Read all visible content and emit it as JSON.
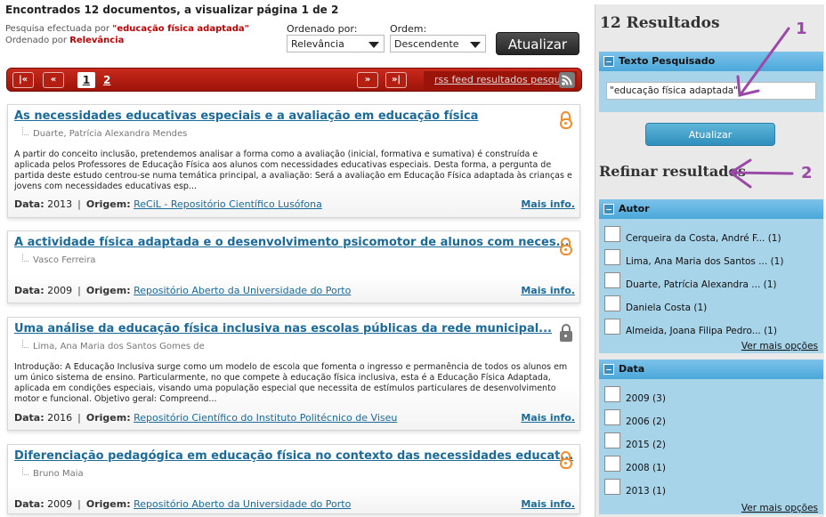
{
  "summary": {
    "title": "Encontrados 12 documentos, a visualizar página 1 de 2",
    "search_prefix": "Pesquisa efectuada por ",
    "search_value": "\"educação física adaptada\"",
    "order_prefix": "Ordenado por ",
    "order_value": "Relevância"
  },
  "sort": {
    "order_by_label": "Ordenado por:",
    "order_by_value": "Relevância",
    "order_label": "Ordem:",
    "order_value": "Descendente",
    "update_label": "Atualizar"
  },
  "pager": {
    "first": "|«",
    "prev": "«",
    "pages": [
      "1",
      "2"
    ],
    "next": "»",
    "last": "»|",
    "rss_label": "rss feed resultados pesquisa"
  },
  "results": [
    {
      "title": "As necessidades educativas especiais e a avaliação em educação física",
      "author": "Duarte, Patrícia Alexandra Mendes",
      "abstract": "A partir do conceito inclusão, pretendemos analisar a forma como a avaliação (inicial, formativa e sumativa) é construída e aplicada pelos Professores de Educação Física aos alunos com necessidades educativas especiais. Desta forma, a pergunta de partida deste estudo centrou-se numa temática principal, a avaliação: Será a avaliação em Educação Física adaptada às crianças e jovens com necessidades educativas esp...",
      "date_label": "Data:",
      "date": "2013",
      "origin_label": "Origem:",
      "origin": "ReCiL - Repositório Científico Lusófona",
      "more": "Mais info.",
      "access": "open-access-icon"
    },
    {
      "title": "A actividade física adaptada e o desenvolvimento psicomotor de alunos com neces...",
      "author": "Vasco Ferreira",
      "abstract": "",
      "date_label": "Data:",
      "date": "2009",
      "origin_label": "Origem:",
      "origin": "Repositório Aberto da Universidade do Porto",
      "more": "Mais info.",
      "access": "open-access-icon"
    },
    {
      "title": "Uma análise da educação física inclusiva nas escolas públicas da rede municipal...",
      "author": "Lima, Ana Maria dos Santos Gomes de",
      "abstract": "Introdução: A Educação Inclusiva surge como um modelo de escola que fomenta o ingresso e permanência de todos os alunos em um único sistema de ensino. Particularmente, no que compete à educação física inclusiva, esta é a Educação Física Adaptada, aplicada em condições especiais, visando uma população especial que necessita de estímulos particulares de desenvolvimento motor e funcional. Objetivo geral: Compreend...",
      "date_label": "Data:",
      "date": "2016",
      "origin_label": "Origem:",
      "origin": "Repositório Científico do Instituto Politécnico de Viseu",
      "more": "Mais info.",
      "access": "restricted-access-icon"
    },
    {
      "title": "Diferenciação pedagógica em educação física no contexto das necessidades educat...",
      "author": "Bruno Maia",
      "abstract": "",
      "date_label": "Data:",
      "date": "2009",
      "origin_label": "Origem:",
      "origin": "Repositório Aberto da Universidade do Porto",
      "more": "Mais info.",
      "access": "open-access-icon"
    }
  ],
  "sidebar": {
    "results_count": "12 Resultados",
    "search_panel_title": "Texto Pesquisado",
    "search_text": "\"educação física adaptada\"",
    "update_label": "Atualizar",
    "refine_title": "Refinar resultados",
    "author_panel_title": "Autor",
    "authors": [
      "Cerqueira da Costa, André F... (1)",
      "Lima, Ana Maria dos Santos ... (1)",
      "Duarte, Patrícia Alexandra ... (1)",
      "Daniela Costa (1)",
      "Almeida, Joana Filipa Pedro... (1)"
    ],
    "date_panel_title": "Data",
    "dates": [
      "2009 (3)",
      "2006 (2)",
      "2015 (2)",
      "2008 (1)",
      "2013 (1)"
    ],
    "more_options": "Ver mais opções"
  },
  "annotations": {
    "one": "1",
    "two": "2"
  },
  "colors": {
    "pager_red": "#b41f12",
    "link_blue": "#1a6a9a",
    "panel_blue": "#a8d4ea",
    "annotation_purple": "#9b49a8",
    "open_access_orange": "#f28c2a"
  }
}
